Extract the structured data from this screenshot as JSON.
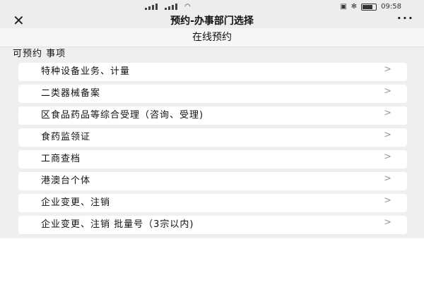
{
  "status_bar": {
    "time": "09:58"
  },
  "nav": {
    "title": "预约-办事部门选择",
    "close_icon": "close-icon",
    "more_icon": "more-icon",
    "more_glyph": "···"
  },
  "subheader": {
    "title": "在线预约"
  },
  "section": {
    "label": "可预约 事项"
  },
  "items": [
    {
      "label": "特种设备业务、计量"
    },
    {
      "label": "二类器械备案"
    },
    {
      "label": "区食品药品等综合受理（咨询、受理)"
    },
    {
      "label": "食药监领证"
    },
    {
      "label": "工商查档"
    },
    {
      "label": "港澳台个体"
    },
    {
      "label": "企业变更、注销"
    },
    {
      "label": "企业变更、注销 批量号（3宗以内)"
    }
  ],
  "chevron_glyph": ">",
  "colors": {
    "bar_bg": "#ededed",
    "panel_bg": "#efefef",
    "item_bg": "#ffffff",
    "chevron": "#999999"
  }
}
